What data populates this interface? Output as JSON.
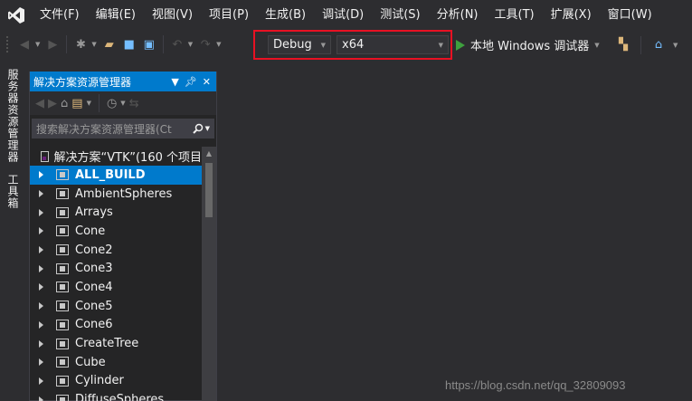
{
  "menubar": {
    "logo_icon": "visual-studio-logo-icon",
    "items": [
      {
        "label": "文件(F)"
      },
      {
        "label": "编辑(E)"
      },
      {
        "label": "视图(V)"
      },
      {
        "label": "项目(P)"
      },
      {
        "label": "生成(B)"
      },
      {
        "label": "调试(D)"
      },
      {
        "label": "测试(S)"
      },
      {
        "label": "分析(N)"
      },
      {
        "label": "工具(T)"
      },
      {
        "label": "扩展(X)"
      },
      {
        "label": "窗口(W)"
      }
    ]
  },
  "toolbar": {
    "configuration": "Debug",
    "platform": "x64",
    "run_label": "本地 Windows 调试器"
  },
  "side_tabs": {
    "server_explorer": "服务器资源管理器",
    "toolbox": "工具箱"
  },
  "solution_explorer": {
    "title": "解决方案资源管理器",
    "search_placeholder": "搜索解决方案资源管理器(Ct",
    "root_label": "解决方案“VTK”(160 个项目",
    "items": [
      {
        "label": "ALL_BUILD"
      },
      {
        "label": "AmbientSpheres"
      },
      {
        "label": "Arrays"
      },
      {
        "label": "Cone"
      },
      {
        "label": "Cone2"
      },
      {
        "label": "Cone3"
      },
      {
        "label": "Cone4"
      },
      {
        "label": "Cone5"
      },
      {
        "label": "Cone6"
      },
      {
        "label": "CreateTree"
      },
      {
        "label": "Cube"
      },
      {
        "label": "Cylinder"
      },
      {
        "label": "DiffuseSpheres"
      }
    ]
  },
  "watermark": "https://blog.csdn.net/qq_32809093",
  "colors": {
    "accent": "#007acc",
    "highlight_box": "#e81123",
    "run_green": "#3ea03e",
    "background": "#2d2d30"
  }
}
